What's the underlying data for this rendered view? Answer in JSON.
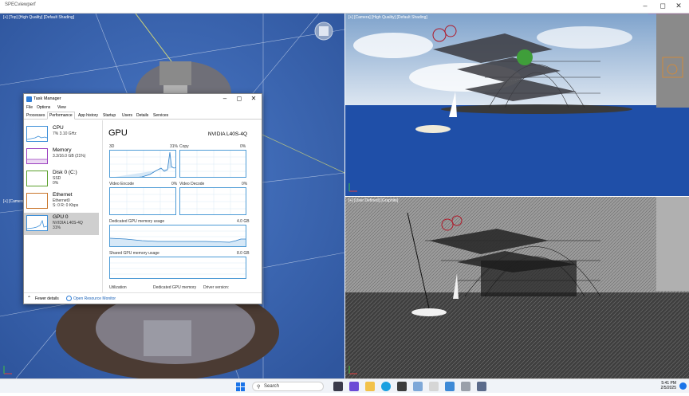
{
  "app": {
    "title": "SPECviewperf"
  },
  "viewports": {
    "left": {
      "label": "[+] [Top] [High Quality] [Default Shading]",
      "bottom_label": "[+] [Camera]"
    },
    "top_right": {
      "label": "[+] [Camera] [High Quality] [Default Shading]"
    },
    "bottom_right": {
      "label": "[+] [User Defined] [Graphite]"
    }
  },
  "task_manager": {
    "title": "Task Manager",
    "menu": [
      "File",
      "Options",
      "View"
    ],
    "tabs": [
      "Processes",
      "Performance",
      "App history",
      "Startup",
      "Users",
      "Details",
      "Services"
    ],
    "active_tab": "Performance",
    "resources": [
      {
        "name": "CPU",
        "sub1": "7% 3.10 GHz",
        "sub2": "",
        "color": "#3b8ed8"
      },
      {
        "name": "Memory",
        "sub1": "3.3/16.0 GB (21%)",
        "sub2": "",
        "color": "#9b3fbf"
      },
      {
        "name": "Disk 0 (C:)",
        "sub1": "SSD",
        "sub2": "0%",
        "color": "#5aa02c"
      },
      {
        "name": "Ethernet",
        "sub1": "Ethernet0",
        "sub2": "S: 0 R: 0 Kbps",
        "color": "#c9762b"
      },
      {
        "name": "GPU 0",
        "sub1": "NVIDIA L40S-4Q",
        "sub2": "31%",
        "color": "#3b8ed8"
      }
    ],
    "gpu": {
      "heading": "GPU",
      "model": "NVIDIA L40S-4Q",
      "engines": [
        {
          "name": "3D",
          "value": "31%"
        },
        {
          "name": "Copy",
          "value": "0%"
        },
        {
          "name": "Video Encode",
          "value": "0%"
        },
        {
          "name": "Video Decode",
          "value": "0%"
        }
      ],
      "dedicated_label": "Dedicated GPU memory usage",
      "dedicated_max": "4.0 GB",
      "shared_label": "Shared GPU memory usage",
      "shared_max": "8.0 GB",
      "bottom_labels": [
        "Utilization",
        "Dedicated GPU memory",
        "Driver version:"
      ]
    },
    "footer": {
      "fewer_details": "Fewer details",
      "open_monitor": "Open Resource Monitor"
    }
  },
  "taskbar": {
    "search_placeholder": "Search",
    "time": "5:41 PM",
    "date": "2/5/2025"
  },
  "colors": {
    "accent": "#4d9bd6",
    "viewport_blue": "#3f68b0",
    "sky": "#9fb9d8"
  }
}
